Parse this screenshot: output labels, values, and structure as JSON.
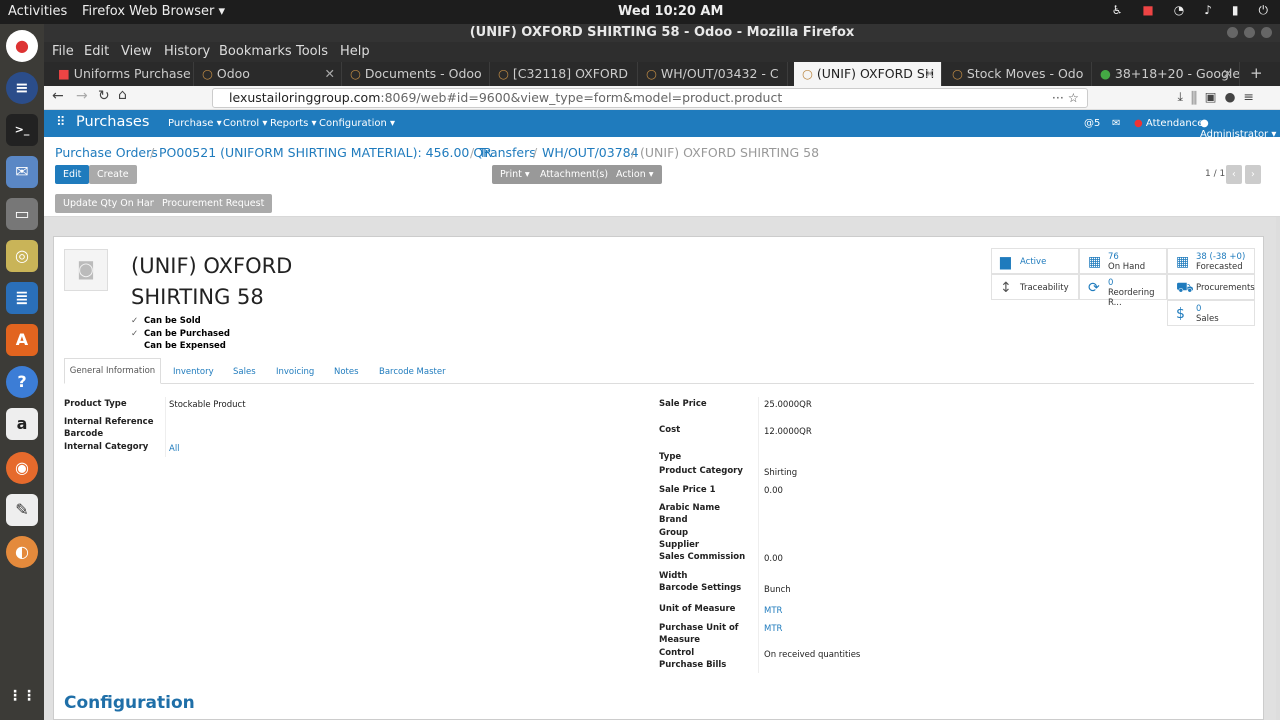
{
  "os": {
    "activities": "Activities",
    "app_menu": "Firefox Web Browser ▾",
    "clock": "Wed 10:20 AM",
    "tray_icons": [
      "accessibility-icon",
      "camera-icon",
      "wifi-icon",
      "volume-icon",
      "battery-icon",
      "power-icon"
    ],
    "dock_icons": [
      "chrome-icon",
      "spotlight-icon",
      "terminal-icon",
      "mail-icon",
      "disk-icon",
      "speaker-icon",
      "writer-icon",
      "software-center-icon",
      "help-icon",
      "amazon-icon",
      "firefox-icon",
      "text-editor-icon",
      "blender-icon",
      "apps-grid-icon"
    ]
  },
  "window": {
    "title": "(UNIF) OXFORD SHIRTING 58 - Odoo - Mozilla Firefox"
  },
  "menubar": [
    "File",
    "Edit",
    "View",
    "History",
    "Bookmarks",
    "Tools",
    "Help"
  ],
  "tabs": [
    {
      "label": "Uniforms Purchase",
      "active": false
    },
    {
      "label": "Odoo",
      "active": false
    },
    {
      "label": "Documents - Odoo",
      "active": false
    },
    {
      "label": "[C32118] OXFORD",
      "active": false
    },
    {
      "label": "WH/OUT/03432 - C",
      "active": false
    },
    {
      "label": "(UNIF) OXFORD SH",
      "active": true
    },
    {
      "label": "Stock Moves - Odo",
      "active": false
    },
    {
      "label": "38+18+20 - Google",
      "active": false
    }
  ],
  "url": {
    "host": "lexustailoringgroup.com",
    "path": ":8069/web#id=9600&view_type=form&model=product.product"
  },
  "odoo_nav": {
    "app": "Purchases",
    "menus": [
      "Purchase ▾",
      "Control ▾",
      "Reports ▾",
      "Configuration ▾"
    ],
    "messages_count": "5",
    "attendance": "Attendance",
    "user": "Administrator ▾"
  },
  "breadcrumbs": [
    "Purchase Orders",
    "PO00521 (UNIFORM SHIRTING MATERIAL): 456.00 QR",
    "Transfers",
    "WH/OUT/03784",
    "(UNIF) OXFORD SHIRTING 58"
  ],
  "buttons": {
    "edit": "Edit",
    "create": "Create",
    "print": "Print ▾",
    "attachments": "Attachment(s) ▾",
    "action": "Action ▾",
    "update_qty": "Update Qty On Hand",
    "procurement": "Procurement Request",
    "pager": "1 / 1"
  },
  "product": {
    "name_line1": "(UNIF) OXFORD",
    "name_line2": "SHIRTING 58",
    "checks": [
      {
        "label": "Can be Sold",
        "checked": true
      },
      {
        "label": "Can be Purchased",
        "checked": true
      },
      {
        "label": "Can be Expensed",
        "checked": false
      }
    ]
  },
  "smart_buttons": [
    {
      "name": "active",
      "icon": "archive-icon",
      "line1": "Active",
      "line2": ""
    },
    {
      "name": "on-hand",
      "icon": "building-icon",
      "line1": "76",
      "line2": "On Hand"
    },
    {
      "name": "forecasted",
      "icon": "building-icon",
      "line1": "38 (-38 +0)",
      "line2": "Forecasted"
    },
    {
      "name": "traceability",
      "icon": "arrows-vertical-icon",
      "line1": "Traceability",
      "line2": ""
    },
    {
      "name": "reordering",
      "icon": "refresh-icon",
      "line1": "0",
      "line2": "Reordering R..."
    },
    {
      "name": "procurements",
      "icon": "truck-icon",
      "line1": "Procurements",
      "line2": ""
    },
    {
      "name": "sales",
      "icon": "dollar-icon",
      "line1": "0",
      "line2": "Sales"
    }
  ],
  "form_tabs": [
    "General Information",
    "Inventory",
    "Sales",
    "Invoicing",
    "Notes",
    "Barcode Master"
  ],
  "left_fields": [
    {
      "label": "Product Type",
      "value": "Stockable Product"
    },
    {
      "label": "Internal Reference",
      "value": ""
    },
    {
      "label": "Barcode",
      "value": ""
    },
    {
      "label": "Internal Category",
      "value": "All"
    }
  ],
  "right_fields": [
    {
      "label": "Sale Price",
      "value": "25.0000QR"
    },
    {
      "label": "Cost",
      "value": "12.0000QR"
    },
    {
      "label": "Type",
      "value": ""
    },
    {
      "label": "Product Category",
      "value": "Shirting"
    },
    {
      "label": "Sale Price 1",
      "value": "0.00"
    },
    {
      "label": "Arabic Name",
      "value": ""
    },
    {
      "label": "Brand",
      "value": ""
    },
    {
      "label": "Group",
      "value": ""
    },
    {
      "label": "Supplier",
      "value": ""
    },
    {
      "label": "Sales Commission",
      "value": "0.00"
    },
    {
      "label": "Width",
      "value": ""
    },
    {
      "label": "Barcode Settings",
      "value": "Bunch"
    },
    {
      "label": "Unit of Measure",
      "value": "MTR"
    },
    {
      "label": "Purchase Unit of Measure",
      "value": "MTR"
    },
    {
      "label": "Control Purchase Bills",
      "value": "On received quantities"
    }
  ],
  "section_title": "Configuration",
  "colors": {
    "odoo_blue": "#1f7bbd",
    "ubuntu_dark": "#1d1d1d",
    "dock": "#3c3b37"
  }
}
